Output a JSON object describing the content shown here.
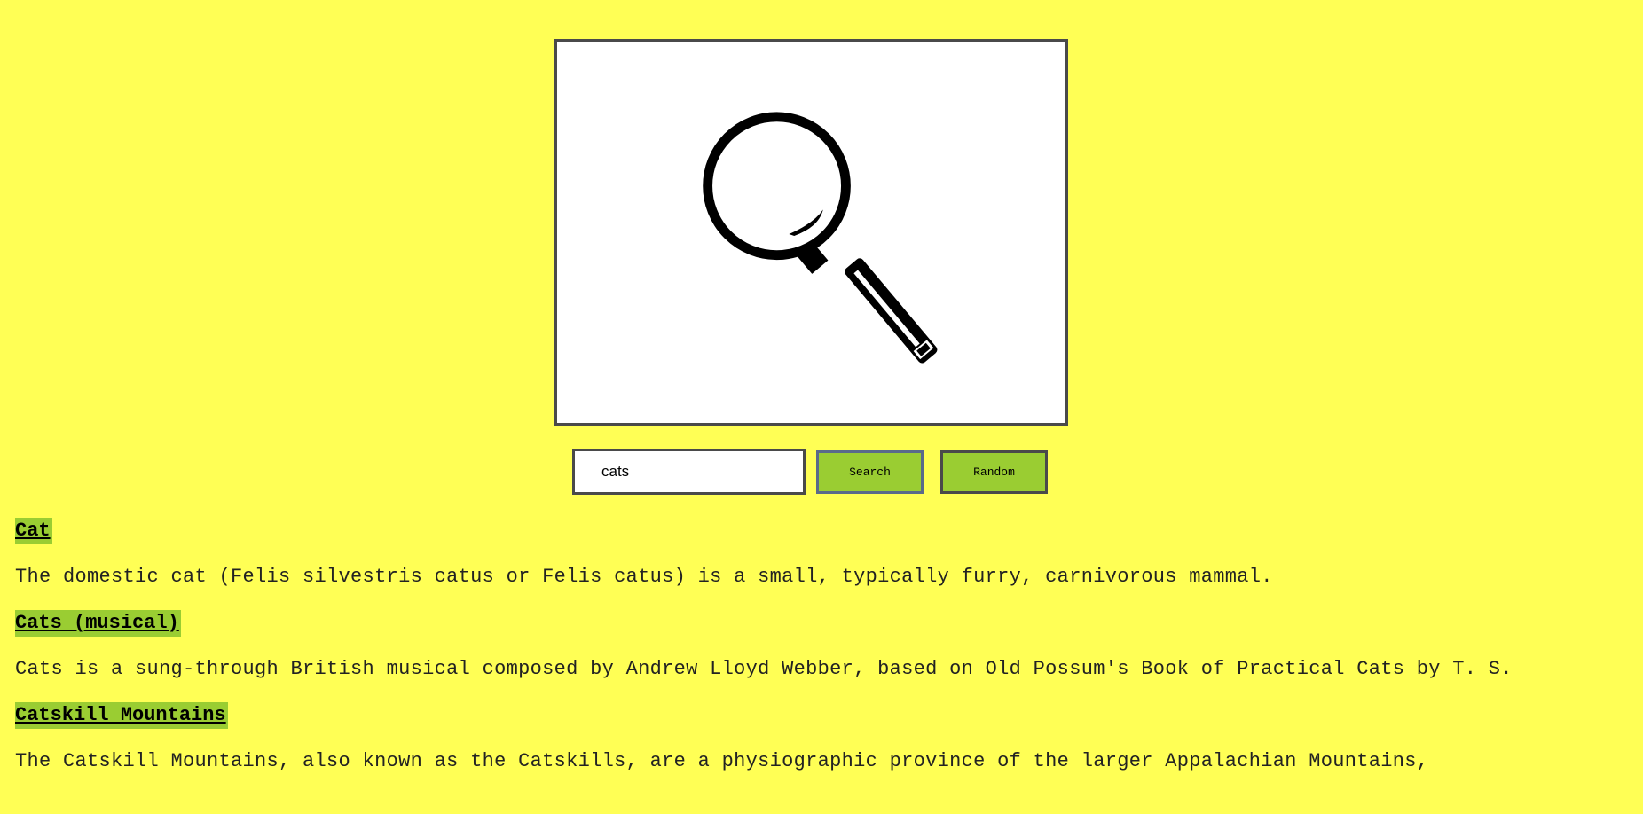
{
  "logo": {
    "icon": "magnifying-glass-icon"
  },
  "search": {
    "value": "cats",
    "placeholder": "",
    "search_label": "Search",
    "random_label": "Random"
  },
  "results": [
    {
      "title": "Cat",
      "snippet": "The domestic cat (Felis silvestris catus or Felis catus) is a small, typically furry, carnivorous mammal."
    },
    {
      "title": "Cats (musical)",
      "snippet": "Cats is a sung-through British musical composed by Andrew Lloyd Webber, based on Old Possum's Book of Practical Cats by T. S."
    },
    {
      "title": "Catskill Mountains",
      "snippet": "The Catskill Mountains, also known as the Catskills, are a physiographic province of the larger Appalachian Mountains,"
    }
  ],
  "colors": {
    "background": "#ffff55",
    "accent": "#9acd32",
    "border": "#4a4a4a"
  }
}
